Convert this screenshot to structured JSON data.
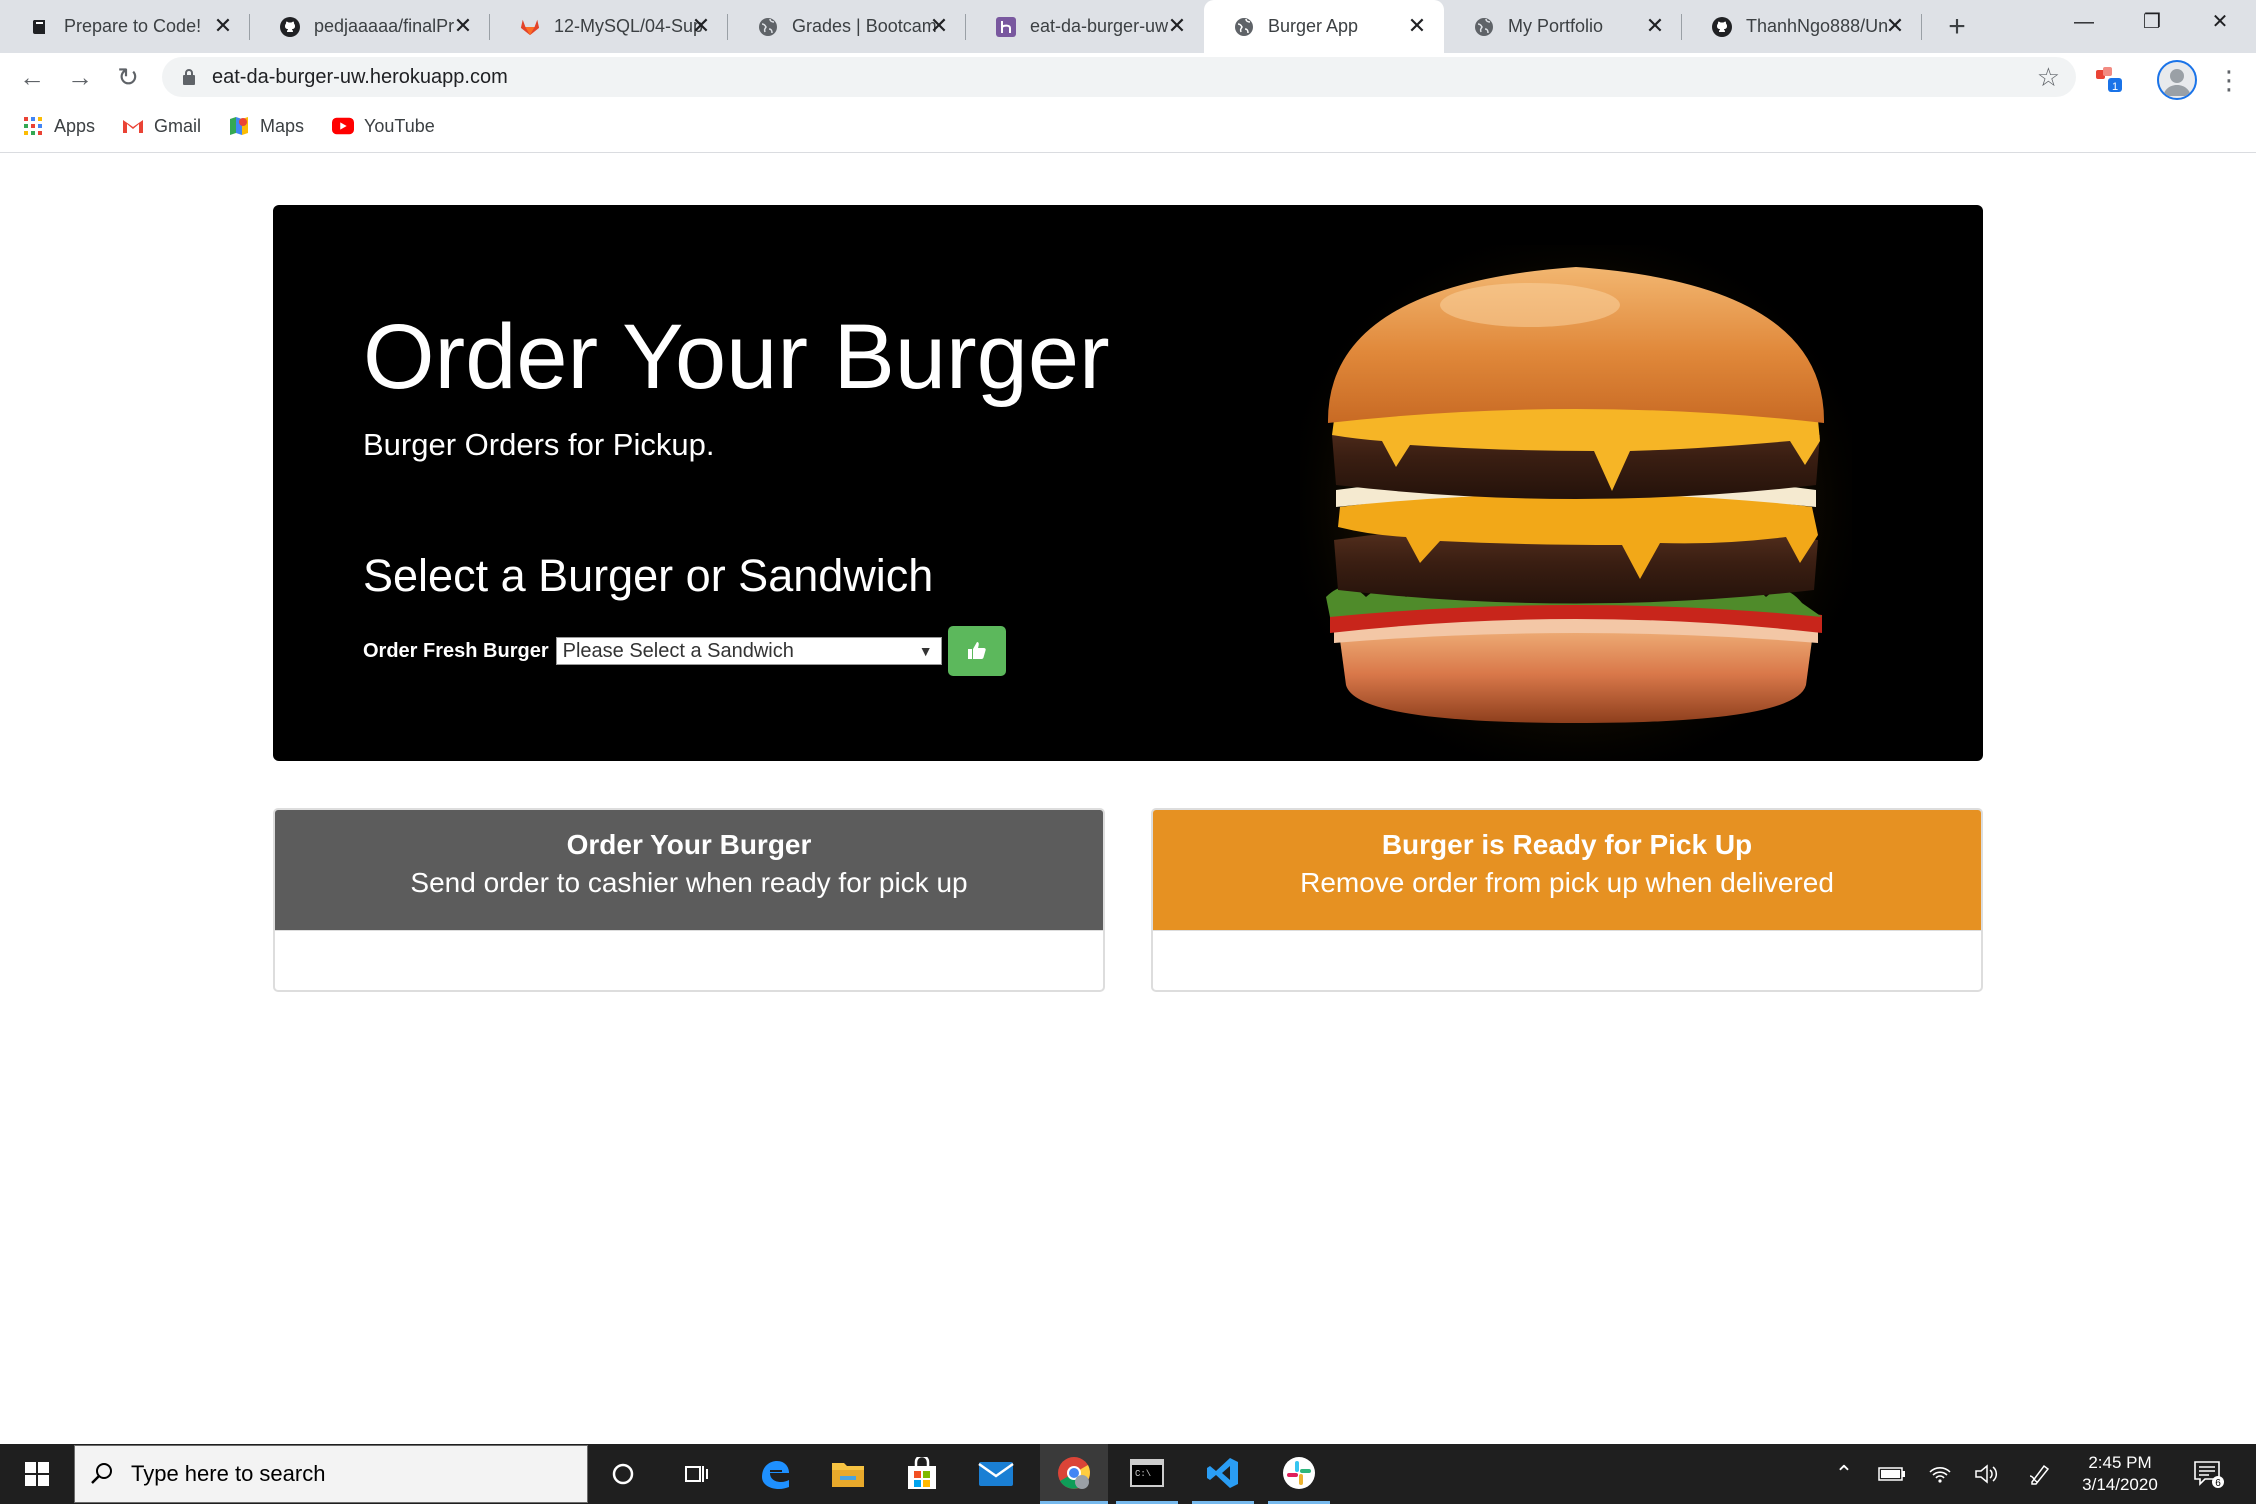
{
  "browser": {
    "tabs": [
      {
        "title": "Prepare to Code!",
        "icon": "book-icon",
        "active": false
      },
      {
        "title": "pedjaaaaa/finalPr",
        "icon": "github-icon",
        "active": false
      },
      {
        "title": "12-MySQL/04-Sup",
        "icon": "gitlab-icon",
        "active": false
      },
      {
        "title": "Grades | Bootcam",
        "icon": "globe-icon",
        "active": false
      },
      {
        "title": "eat-da-burger-uw",
        "icon": "heroku-icon",
        "active": false
      },
      {
        "title": "Burger App",
        "icon": "globe-icon",
        "active": true
      },
      {
        "title": "My Portfolio",
        "icon": "globe-icon",
        "active": false
      },
      {
        "title": "ThanhNgo888/Un",
        "icon": "github-icon",
        "active": false
      }
    ],
    "url": "eat-da-burger-uw.herokuapp.com",
    "extension_badge": "1",
    "bookmarks": [
      {
        "label": "Apps",
        "icon": "apps-grid-icon"
      },
      {
        "label": "Gmail",
        "icon": "gmail-icon"
      },
      {
        "label": "Maps",
        "icon": "maps-icon"
      },
      {
        "label": "YouTube",
        "icon": "youtube-icon"
      }
    ]
  },
  "page": {
    "title": "Order Your Burger",
    "subtitle": "Burger Orders for Pickup.",
    "select_heading": "Select a Burger or Sandwich",
    "order_label": "Order Fresh Burger",
    "select_value": "Please Select a Sandwich",
    "panels": [
      {
        "title": "Order Your Burger",
        "subtitle": "Send order to cashier when ready for pick up",
        "color": "#5c5c5c"
      },
      {
        "title": "Burger is Ready for Pick Up",
        "subtitle": "Remove order from pick up when delivered",
        "color": "#e69122"
      }
    ],
    "accent_green": "#5cb85c"
  },
  "taskbar": {
    "search_placeholder": "Type here to search",
    "time": "2:45 PM",
    "date": "3/14/2020",
    "notification_count": "6"
  }
}
